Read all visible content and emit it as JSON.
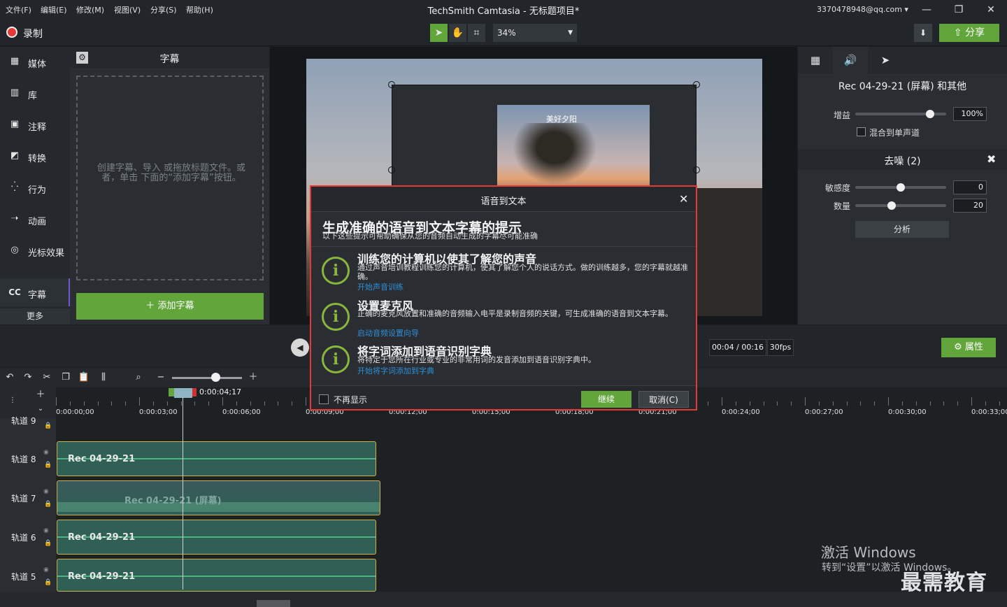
{
  "menu": [
    "文件(F)",
    "编辑(E)",
    "修改(M)",
    "视图(V)",
    "分享(S)",
    "帮助(H)"
  ],
  "app_title": "TechSmith Camtasia - 无标题项目*",
  "account": "3370478948@qq.com ▾",
  "window_controls": {
    "minimize": "—",
    "restore": "❐",
    "close": "✕"
  },
  "toolbar": {
    "record_label": "录制",
    "zoom": "34%",
    "share_label": "⇧ 分享",
    "icons": {
      "select": "arrow-icon",
      "pan": "hand-icon",
      "crop": "crop-icon",
      "download": "download-icon"
    }
  },
  "rail": {
    "items": [
      {
        "label": "媒体",
        "icon": "▦"
      },
      {
        "label": "库",
        "icon": "▥"
      },
      {
        "label": "注释",
        "icon": "▣"
      },
      {
        "label": "转换",
        "icon": "◩"
      },
      {
        "label": "行为",
        "icon": "⁛"
      },
      {
        "label": "动画",
        "icon": "➝"
      },
      {
        "label": "光标效果",
        "icon": "◎"
      },
      {
        "label": "字幕",
        "icon": "CC"
      }
    ],
    "more": "更多"
  },
  "captions": {
    "title": "字幕",
    "hint": "创建字幕、导入 或拖放标题文件。或者，单击 下面的“添加字幕”按钮。",
    "add_label": "＋ 添加字幕"
  },
  "canvas": {
    "inner_caption": "美好夕阳"
  },
  "properties": {
    "title": "Rec 04-29-21 (屏幕) 和其他",
    "gain_label": "增益",
    "gain_value": "100%",
    "gain_level": 0.82,
    "mono_label": "混合到单声道",
    "denoise_title": "去噪 (2)",
    "sensitivity_label": "敏感度",
    "sensitivity_value": "0",
    "sensitivity_level": 0.5,
    "amount_label": "数量",
    "amount_value": "20",
    "amount_level": 0.4,
    "analyze_label": "分析"
  },
  "playback": {
    "time": "00:04 / 00:16",
    "fps": "30fps",
    "props_label": "⚙ 属性"
  },
  "timeline": {
    "playhead": "0:00:04;17",
    "ticks": [
      "0:00:00;00",
      "0:00:03;00",
      "0:00:06;00",
      "0:00:09;00",
      "0:00:12;00",
      "0:00:15;00",
      "0:00:18;00",
      "0:00:21;00",
      "0:00:24;00",
      "0:00:27;00",
      "0:00:30;00",
      "0:00:33;00"
    ],
    "tracks": [
      {
        "name": "轨道 9",
        "clip": ""
      },
      {
        "name": "轨道 8",
        "clip": "Rec 04-29-21"
      },
      {
        "name": "轨道 7",
        "clip": "Rec 04-29-21 (屏幕)"
      },
      {
        "name": "轨道 6",
        "clip": "Rec 04-29-21"
      },
      {
        "name": "轨道 5",
        "clip": "Rec 04-29-21"
      }
    ]
  },
  "watermark": {
    "line1": "激活 Windows",
    "line2": "转到“设置”以激活 Windows。",
    "brand": "最需教育"
  },
  "modal": {
    "title": "语音到文本",
    "heading": "生成准确的语音到文本字幕的提示",
    "subheading": "以下这些提示可帮助确保从您的音频自动生成的字幕尽可能准确",
    "tips": [
      {
        "title": "训练您的计算机以使其了解您的声音",
        "body": "通过声音培训教程训练您的计算机，使其了解您个人的说话方式。做的训练越多，您的字幕就越准确。",
        "link": "开始声音训练"
      },
      {
        "title": "设置麦克风",
        "body": "正确的麦克风放置和准确的音频输入电平是录制音频的关键，可生成准确的语音到文本字幕。",
        "link": "启动音频设置向导"
      },
      {
        "title": "将字词添加到语音识别字典",
        "body": "将特定于您所在行业或专业的非常用词的发音添加到语音识别字典中。",
        "link": "开始将字词添加到字典"
      }
    ],
    "dont_show": "不再显示",
    "continue_label": "继续",
    "cancel_label": "取消(C)"
  },
  "colors": {
    "accent": "#62a53b",
    "alert": "#e53935",
    "link": "#2f8fd8"
  }
}
